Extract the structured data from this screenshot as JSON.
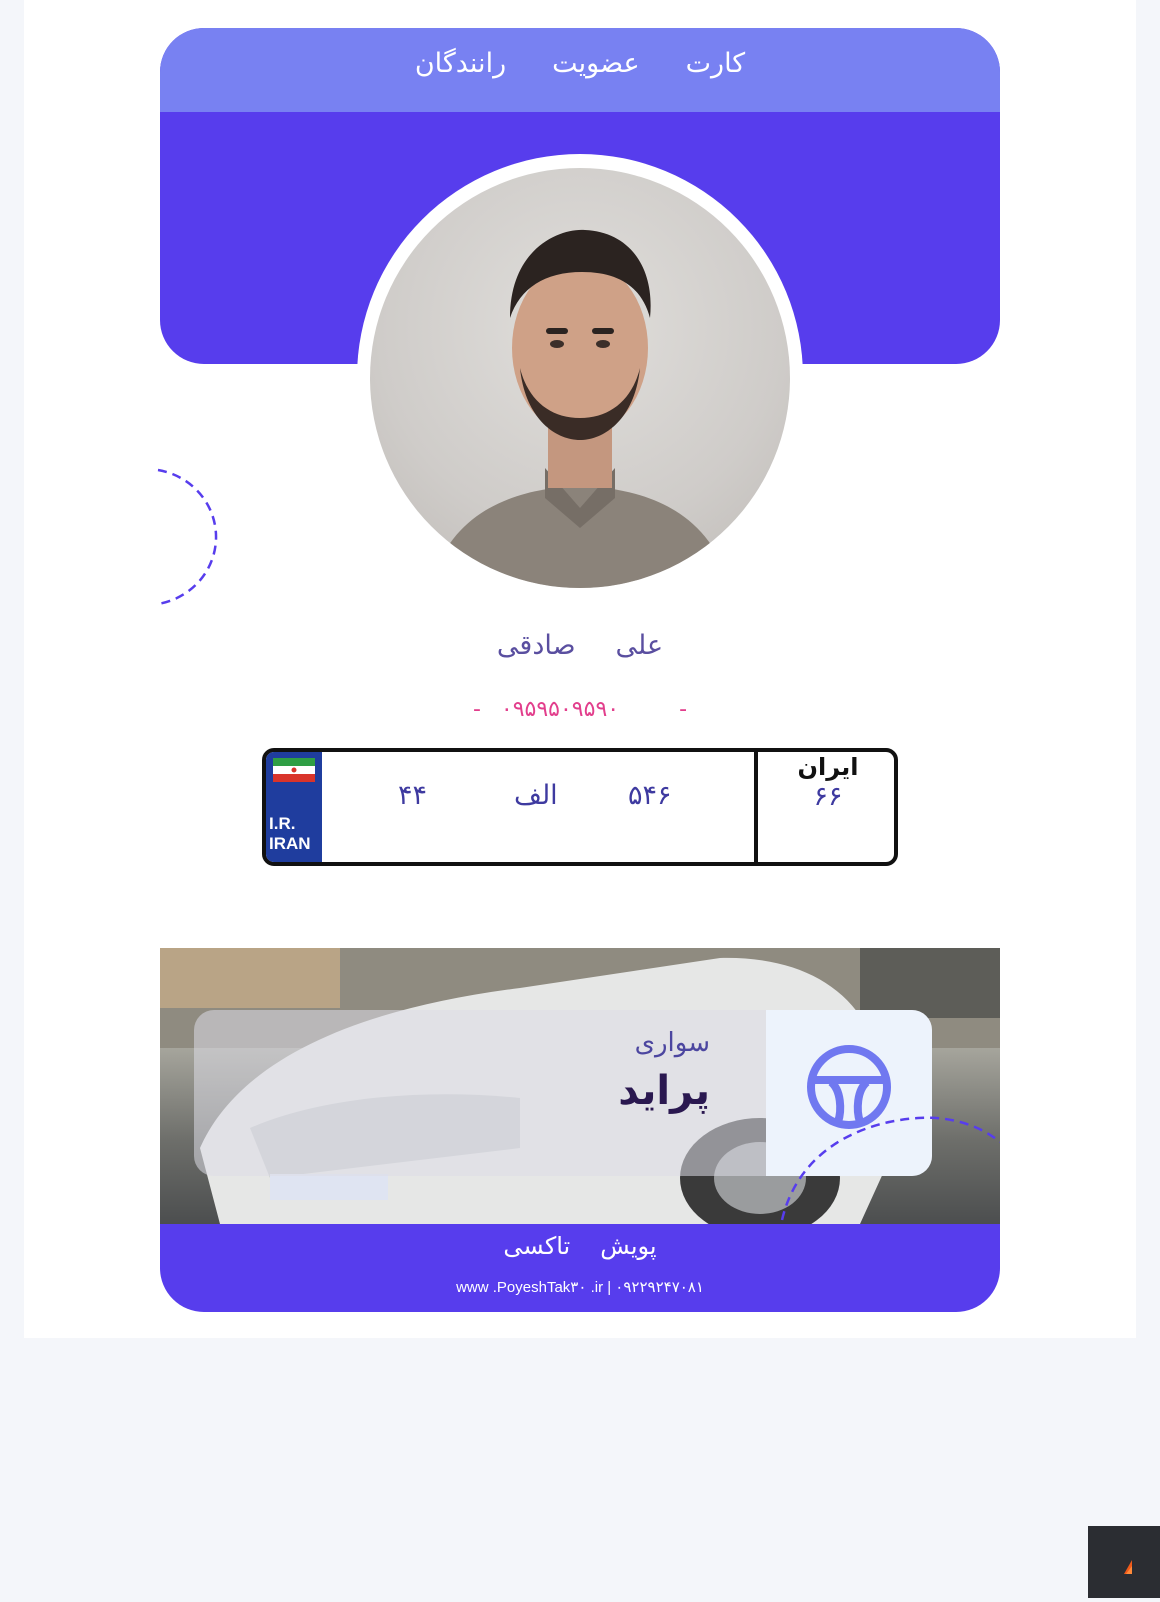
{
  "header": {
    "words": [
      "کارت",
      "عضویت",
      "رانندگان"
    ]
  },
  "driver": {
    "first_name": "علی",
    "last_name": "صادقی",
    "phone_dash_left": "-",
    "phone": "۰۹۵۹۵۰۹۵۹۰",
    "phone_dash_right": "-"
  },
  "plate": {
    "flag_country": "IR",
    "ir_line1": "I.R.",
    "ir_line2": "IRAN",
    "part1": "۴۴",
    "letter": "الف",
    "part2": "۵۴۶",
    "region_label": "ایران",
    "region_code": "۶۶"
  },
  "car": {
    "category": "سواری",
    "model": "پراید",
    "icon": "steering-wheel-icon"
  },
  "footer": {
    "brand_words": [
      "پویش",
      "تاکسی"
    ],
    "contact": "www   .PoyeshTak۳۰        .ir  |  ۰۹۲۲۹۲۴۷۰۸۱"
  },
  "colors": {
    "primary": "#573ded",
    "header": "#7881f2",
    "accent": "#e23e8c"
  }
}
